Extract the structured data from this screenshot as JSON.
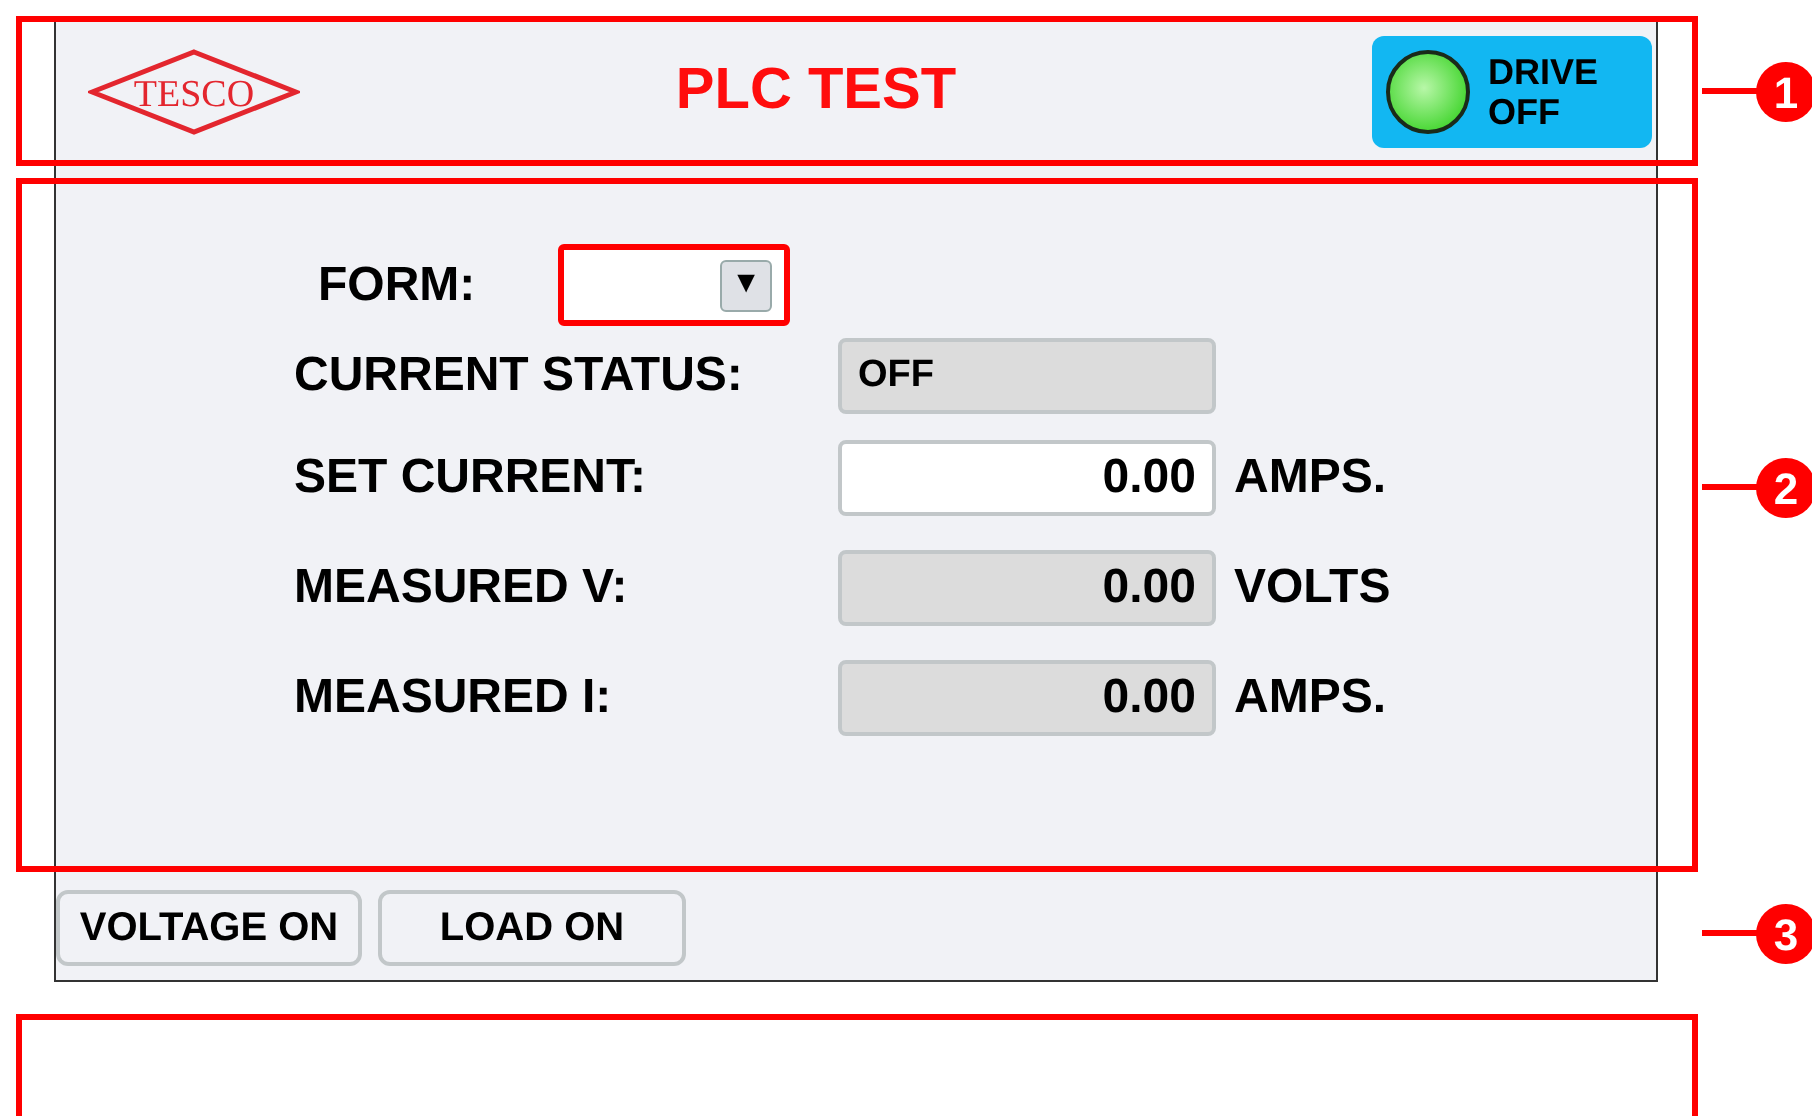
{
  "header": {
    "logo": "TESCO",
    "title": "PLC TEST",
    "drive_indicator": {
      "label": "DRIVE OFF"
    }
  },
  "form_selector": {
    "label": "FORM:",
    "dropdown_arrow": "▼"
  },
  "rows": [
    {
      "kind": "display",
      "label": "CURRENT STATUS:",
      "value": "OFF"
    },
    {
      "kind": "input",
      "label": "SET CURRENT:",
      "value": "0.00",
      "unit": "AMPS."
    },
    {
      "kind": "readout",
      "label": "MEASURED V:",
      "value": "0.00",
      "unit": "VOLTS"
    },
    {
      "kind": "readout",
      "label": "MEASURED I:",
      "value": "0.00",
      "unit": "AMPS."
    }
  ],
  "buttons": [
    "VOLTAGE ON",
    "LOAD ON"
  ],
  "callouts": [
    "1",
    "2",
    "3"
  ]
}
